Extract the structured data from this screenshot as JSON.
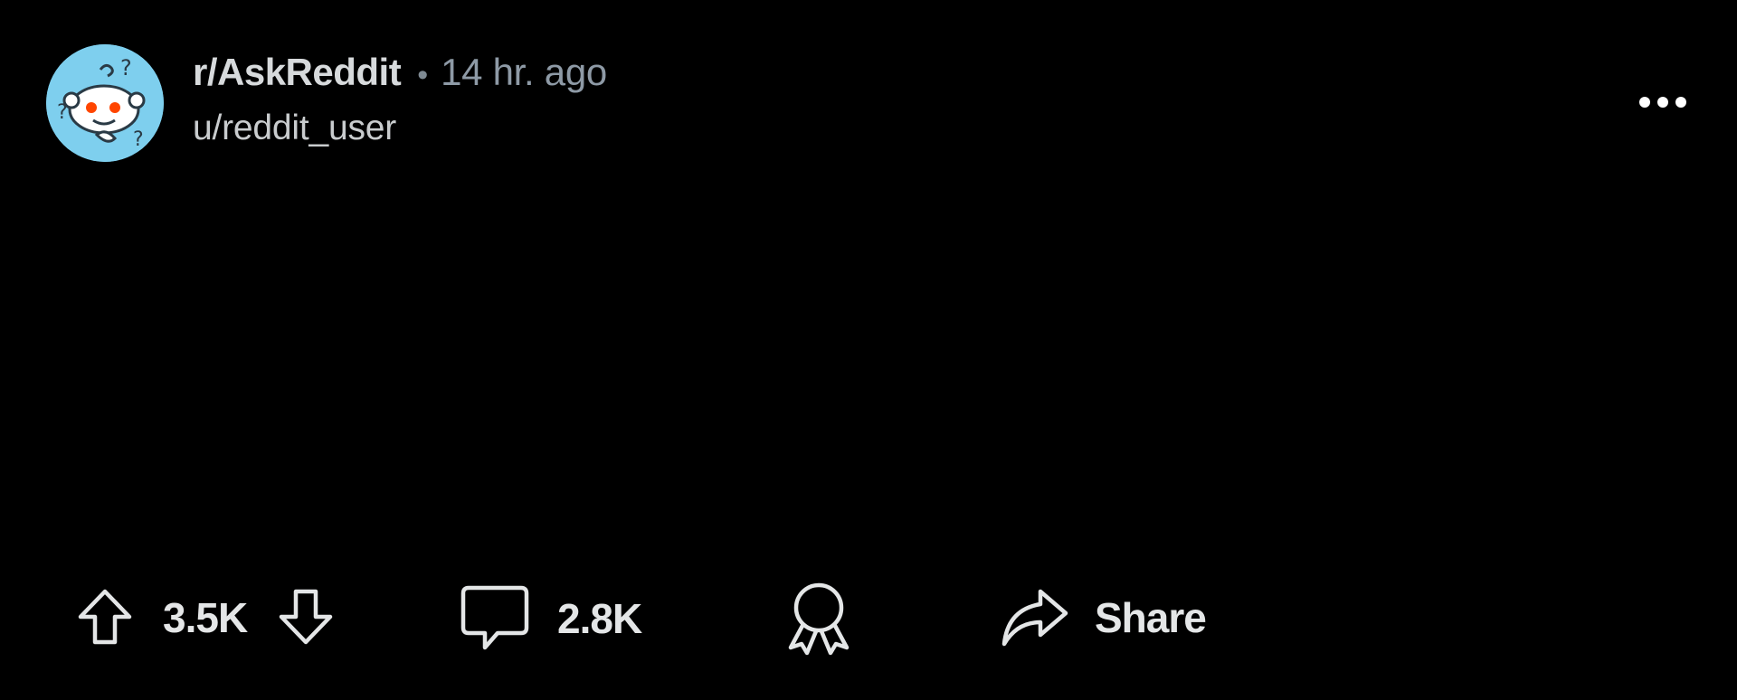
{
  "post": {
    "subreddit": "r/AskReddit",
    "separator": "•",
    "time_ago": "14 hr. ago",
    "username": "u/reddit_user",
    "avatar_icon": "askreddit-snoo-icon",
    "more_icon": "more-options-icon"
  },
  "actions": {
    "upvote_icon": "upvote-arrow-icon",
    "upvote_count": "3.5K",
    "downvote_icon": "downvote-arrow-icon",
    "comment_icon": "comment-bubble-icon",
    "comment_count": "2.8K",
    "award_icon": "award-ribbon-icon",
    "share_icon": "share-arrow-icon",
    "share_label": "Share"
  },
  "colors": {
    "background": "#000000",
    "primary_text": "#d7dadc",
    "secondary_text": "#8e9aa6",
    "avatar_bg": "#7ecfee",
    "icon_stroke": "#e4e6e7"
  }
}
